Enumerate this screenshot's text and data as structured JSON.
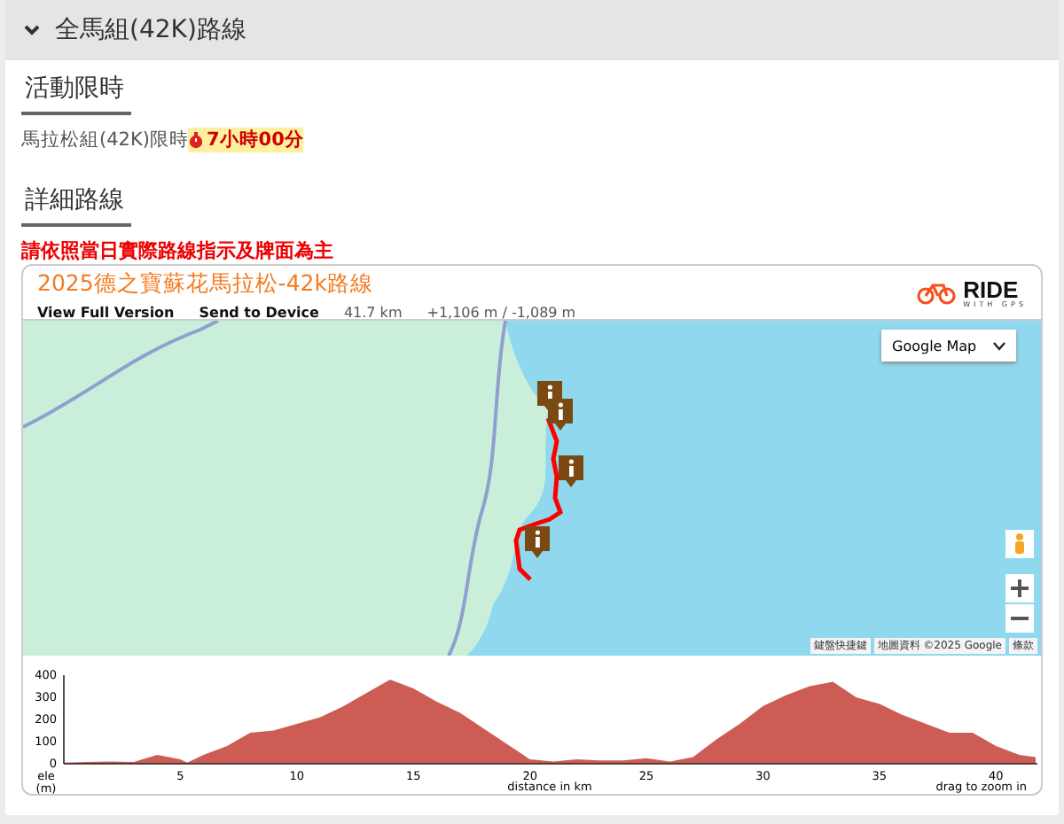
{
  "section": {
    "title": "全馬組(42K)路線",
    "expanded": true
  },
  "time_limit": {
    "heading": "活動限時",
    "label": "馬拉松組(42K)限時",
    "value": "7小時00分"
  },
  "route": {
    "heading": "詳細路線",
    "notice": "請依照當日實際路線指示及牌面為主",
    "embed": {
      "title": "2025德之寶蘇花馬拉松-42k路線",
      "links": [
        "View Full Version",
        "Send to Device"
      ],
      "distance": "41.7 km",
      "elevation": "+1,106 m / -1,089 m",
      "logo": {
        "text": "RIDE",
        "subtext": "WITH GPS"
      },
      "map": {
        "type_selector": "Google Map",
        "attribution": [
          "鍵盤快捷鍵",
          "地圖資料 ©2025 Google",
          "條款"
        ]
      },
      "chart_data": {
        "type": "area",
        "xlabel": "distance in km",
        "ylabel": "ele (m)",
        "x": [
          0,
          1,
          2,
          3,
          4,
          5,
          5.3,
          6,
          7,
          8,
          9,
          10,
          11,
          12,
          13,
          14,
          15,
          16,
          17,
          18,
          19,
          20,
          21,
          22,
          23,
          24,
          25,
          26,
          27,
          28,
          29,
          30,
          31,
          32,
          33,
          34,
          35,
          36,
          37,
          38,
          39,
          40,
          41,
          41.7
        ],
        "values": [
          5,
          8,
          10,
          8,
          40,
          20,
          5,
          40,
          80,
          140,
          150,
          180,
          210,
          260,
          320,
          380,
          340,
          280,
          230,
          160,
          90,
          20,
          10,
          20,
          15,
          15,
          25,
          10,
          30,
          110,
          180,
          260,
          310,
          350,
          370,
          300,
          270,
          220,
          180,
          140,
          140,
          80,
          40,
          30
        ],
        "xlim": [
          0,
          41.7
        ],
        "ylim": [
          0,
          400
        ],
        "xticks": [
          5,
          10,
          15,
          20,
          25,
          30,
          35,
          40
        ],
        "yticks": [
          0,
          100,
          200,
          300,
          400
        ]
      },
      "hint": "drag to zoom in"
    }
  }
}
